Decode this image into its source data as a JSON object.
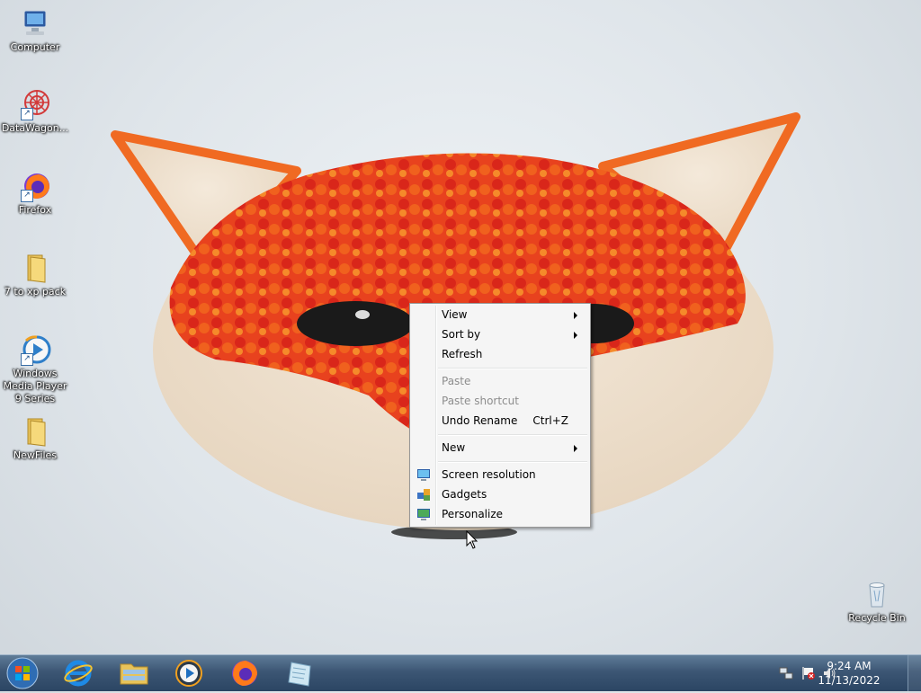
{
  "desktop_icons": [
    {
      "label": "Computer",
      "icon": "computer-icon"
    },
    {
      "label": "DataWagon...",
      "icon": "datawagon-shortcut-icon"
    },
    {
      "label": "Firefox",
      "icon": "firefox-shortcut-icon"
    },
    {
      "label": "7 to xp pack",
      "icon": "folder-icon"
    },
    {
      "label": "Windows Media Player 9 Series",
      "icon": "windows-media-player-icon"
    },
    {
      "label": "NewFiles",
      "icon": "folder-icon"
    },
    {
      "label": "Recycle Bin",
      "icon": "recycle-bin-icon"
    }
  ],
  "context_menu": {
    "view": "View",
    "sort_by": "Sort by",
    "refresh": "Refresh",
    "paste": "Paste",
    "paste_shortcut": "Paste shortcut",
    "undo_rename": "Undo Rename",
    "undo_rename_shortcut": "Ctrl+Z",
    "new": "New",
    "screen_resolution": "Screen resolution",
    "gadgets": "Gadgets",
    "personalize": "Personalize"
  },
  "taskbar": {
    "pinned": [
      "start-orb-icon",
      "internet-explorer-icon",
      "windows-explorer-icon",
      "windows-media-player-icon",
      "firefox-icon",
      "notepad-icon"
    ]
  },
  "tray": {
    "time": "9:24 AM",
    "date": "11/13/2022"
  },
  "colors": {
    "taskbar": "#3c5674",
    "menu_bg": "#f5f5f5",
    "disabled_text": "#8d8d8d"
  }
}
